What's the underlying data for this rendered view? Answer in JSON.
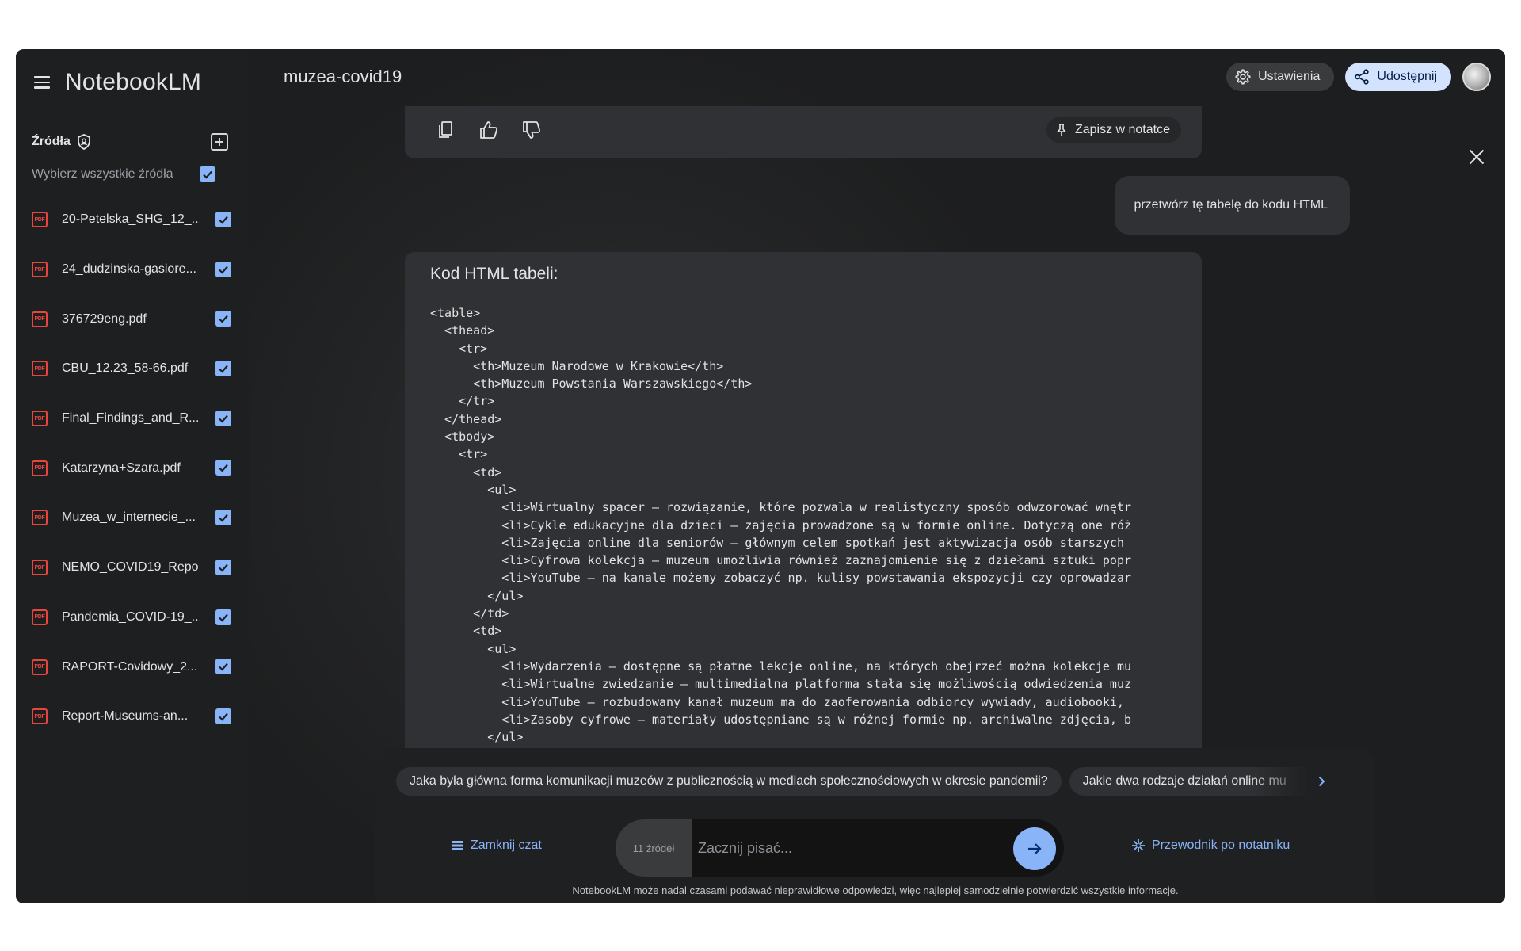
{
  "app": {
    "name": "NotebookLM",
    "notebook_title": "muzea-covid19"
  },
  "header": {
    "settings_label": "Ustawienia",
    "share_label": "Udostępnij"
  },
  "sidebar": {
    "sources_title": "Źródła",
    "select_all_label": "Wybierz wszystkie źródła",
    "pdf_badge": "PDF",
    "items": [
      {
        "name": "20-Petelska_SHG_12_...",
        "checked": true
      },
      {
        "name": "24_dudzinska-gasiore...",
        "checked": true
      },
      {
        "name": "376729eng.pdf",
        "checked": true
      },
      {
        "name": "CBU_12.23_58-66.pdf",
        "checked": true
      },
      {
        "name": "Final_Findings_and_R...",
        "checked": true
      },
      {
        "name": "Katarzyna+Szara.pdf",
        "checked": true
      },
      {
        "name": "Muzea_w_internecie_...",
        "checked": true
      },
      {
        "name": "NEMO_COVID19_Repo...",
        "checked": true
      },
      {
        "name": "Pandemia_COVID-19_...",
        "checked": true
      },
      {
        "name": "RAPORT-Covidowy_2...",
        "checked": true
      },
      {
        "name": "Report-Museums-an...",
        "checked": true
      }
    ]
  },
  "chat": {
    "save_note_label": "Zapisz w notatce",
    "user_message": "przetwórz tę tabelę do kodu HTML",
    "answer_heading": "Kod HTML tabeli:",
    "code_lines": [
      "<table>",
      "  <thead>",
      "    <tr>",
      "      <th>Muzeum Narodowe w Krakowie</th>",
      "      <th>Muzeum Powstania Warszawskiego</th>",
      "    </tr>",
      "  </thead>",
      "  <tbody>",
      "    <tr>",
      "      <td>",
      "        <ul>",
      "          <li>Wirtualny spacer – rozwiązanie, które pozwala w realistyczny sposób odwzorować wnętr",
      "          <li>Cykle edukacyjne dla dzieci – zajęcia prowadzone są w formie online. Dotyczą one róż",
      "          <li>Zajęcia online dla seniorów – głównym celem spotkań jest aktywizacja osób starszych ",
      "          <li>Cyfrowa kolekcja – muzeum umożliwia również zaznajomienie się z dziełami sztuki popr",
      "          <li>YouTube – na kanale możemy zobaczyć np. kulisy powstawania ekspozycji czy oprowadzar",
      "        </ul>",
      "      </td>",
      "      <td>",
      "        <ul>",
      "          <li>Wydarzenia – dostępne są płatne lekcje online, na których obejrzeć można kolekcje mu",
      "          <li>Wirtualne zwiedzanie – multimedialna platforma stała się możliwością odwiedzenia muz",
      "          <li>YouTube – rozbudowany kanał muzeum ma do zaoferowania odbiorcy wywiady, audiobooki, ",
      "          <li>Zasoby cyfrowe – materiały udostępniane są w różnej formie np. archiwalne zdjęcia, b",
      "        </ul>"
    ]
  },
  "composer": {
    "suggestions": [
      "Jaka była główna forma komunikacji muzeów z publicznością w mediach społecznościowych w okresie pandemii?",
      "Jakie dwa rodzaje działań online mu"
    ],
    "close_chat_label": "Zamknij czat",
    "sources_count": "11 źródeł",
    "input_placeholder": "Zacznij pisać...",
    "guide_label": "Przewodnik po notatniku",
    "disclaimer": "NotebookLM może nadal czasami podawać nieprawidłowe odpowiedzi, więc najlepiej samodzielnie potwierdzić wszystkie informacje."
  },
  "colors": {
    "accent": "#8ab4f8",
    "share_bg": "#d3e3fd",
    "pdf_red": "#e8453c"
  }
}
